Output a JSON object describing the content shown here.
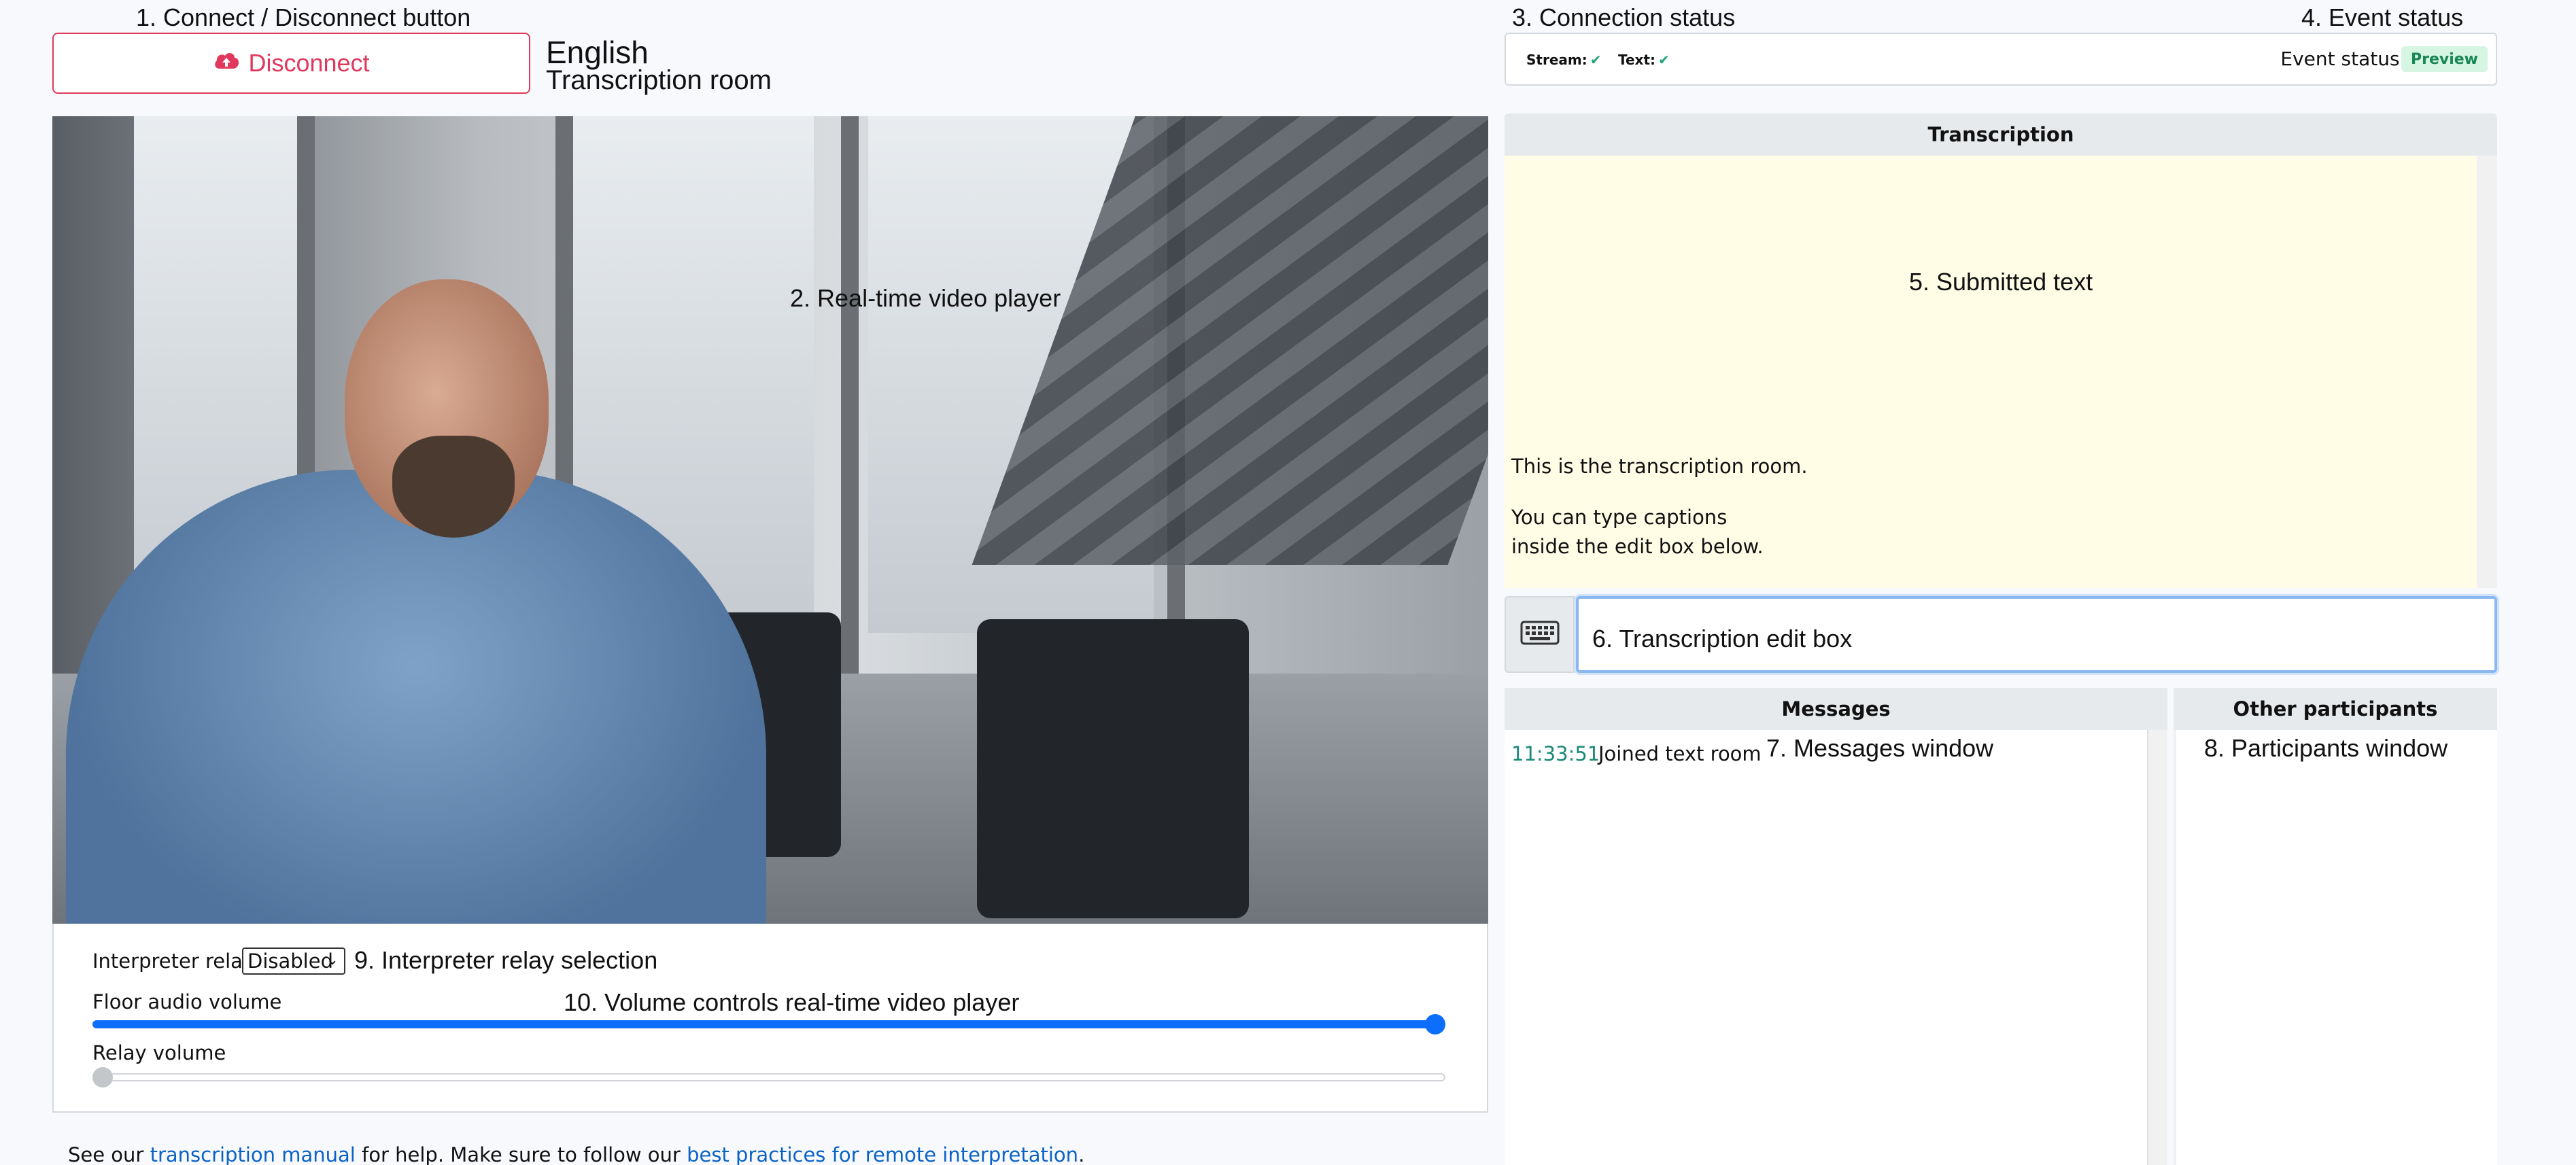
{
  "annotations": {
    "connect": "1. Connect / Disconnect button",
    "video": "2. Real-time video player",
    "connection_status": "3. Connection status",
    "event_status": "4. Event status",
    "submitted_text": "5. Submitted text",
    "edit_box": "6. Transcription edit box",
    "messages": "7. Messages window",
    "participants": "8. Participants window",
    "relay_selection": "9. Interpreter relay selection",
    "volume_controls": "10. Volume controls real-time video player"
  },
  "header": {
    "disconnect_label": "Disconnect",
    "language": "English",
    "room": "Transcription room"
  },
  "status": {
    "stream_label": "Stream:",
    "text_label": "Text:",
    "check": "✔",
    "event_status_label": "Event status:",
    "event_status_value": "Preview"
  },
  "controls": {
    "relay_label": "Interpreter relay:",
    "relay_selected": "Disabled",
    "floor_volume_label": "Floor audio volume",
    "floor_volume_level": 1.0,
    "relay_volume_label": "Relay volume",
    "relay_volume_level": 0.0
  },
  "footer": {
    "text1": "See our ",
    "link1": "transcription manual",
    "text2": " for help. Make sure to follow our ",
    "link2": "best practices for remote interpretation",
    "text3": "."
  },
  "transcription": {
    "title": "Transcription",
    "lines": [
      "This is the transcription room.",
      "You can type captions",
      "inside the edit box below."
    ]
  },
  "messages": {
    "title": "Messages",
    "items": [
      {
        "time": "11:33:51",
        "text": "Joined text room"
      }
    ]
  },
  "participants": {
    "title": "Other participants"
  },
  "icons": {
    "disconnect": "cloud-upload-icon",
    "keyboard": "keyboard-icon",
    "check": "check-icon"
  },
  "colors": {
    "danger": "#e0395d",
    "primary": "#0d6efd",
    "success": "#1ea672",
    "transcription_bg": "#fffde6"
  }
}
